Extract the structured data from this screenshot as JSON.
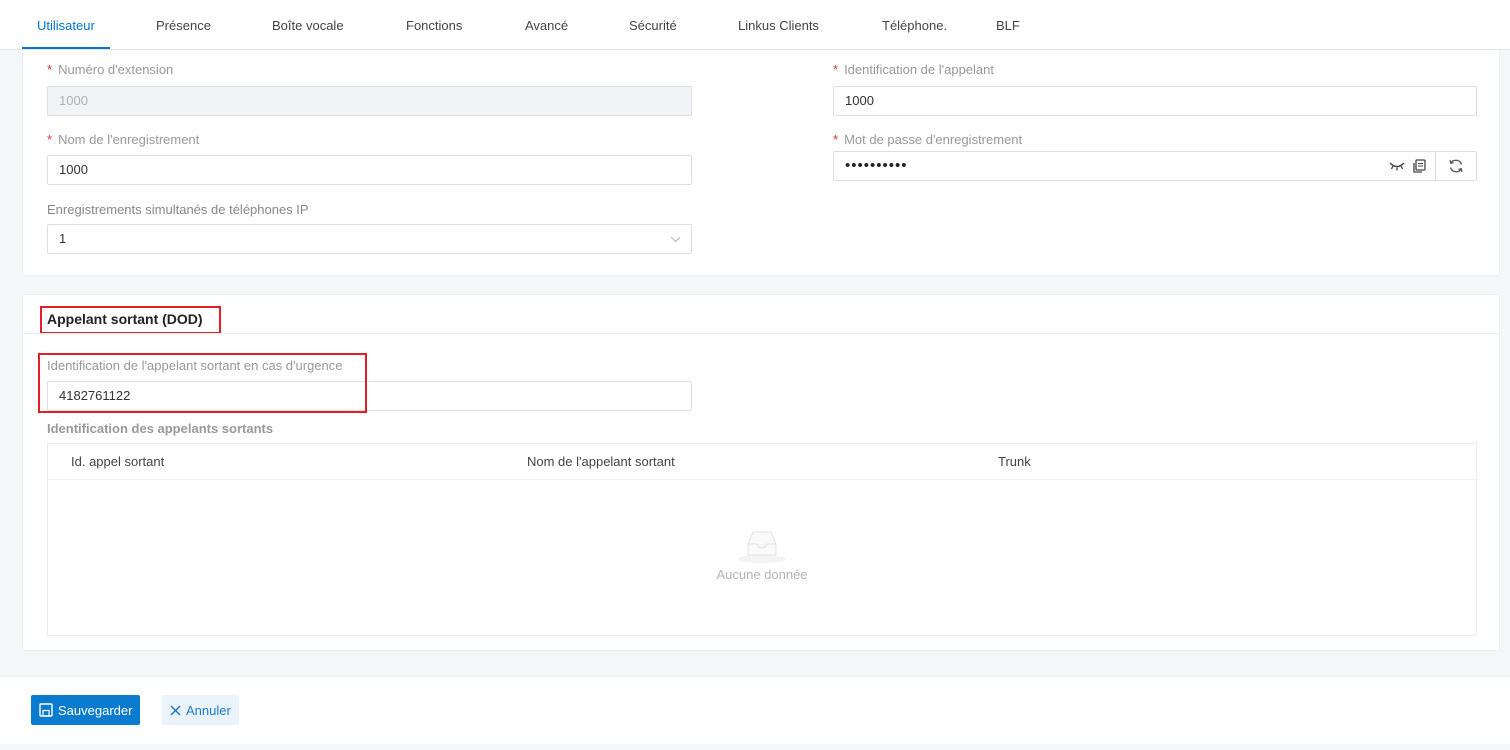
{
  "tabs": [
    {
      "label": "Utilisateur",
      "active": true
    },
    {
      "label": "Présence"
    },
    {
      "label": "Boîte vocale"
    },
    {
      "label": "Fonctions"
    },
    {
      "label": "Avancé"
    },
    {
      "label": "Sécurité"
    },
    {
      "label": "Linkus Clients"
    },
    {
      "label": "Téléphone."
    },
    {
      "label": "BLF"
    }
  ],
  "user": {
    "extension_label": "Numéro d'extension",
    "extension_value": "1000",
    "caller_id_label": "Identification de l'appelant",
    "caller_id_value": "1000",
    "reg_name_label": "Nom de l'enregistrement",
    "reg_name_value": "1000",
    "reg_password_label": "Mot de passe d'enregistrement",
    "reg_password_value": "••••••••••",
    "concurrent_label": "Enregistrements simultanés de téléphones IP",
    "concurrent_value": "1",
    "required_mark": "*"
  },
  "dod": {
    "title": "Appelant sortant (DOD)",
    "emergency_label": "Identification de l'appelant sortant en cas d'urgence",
    "emergency_value": "4182761122",
    "outbound_label": "Identification des appelants sortants",
    "table": {
      "columns": [
        "Id. appel sortant",
        "Nom de l'appelant sortant",
        "Trunk"
      ],
      "rows": [],
      "empty_text": "Aucune donnée"
    }
  },
  "footer": {
    "save_label": "Sauvegarder",
    "cancel_label": "Annuler"
  },
  "colors": {
    "accent": "#0076cc",
    "required": "#e0303a",
    "highlight_box": "#e01f26"
  },
  "icons": [
    "eye-closed-icon",
    "copy-icon",
    "refresh-icon",
    "chevron-down-icon",
    "empty-inbox-icon",
    "save-icon",
    "close-icon"
  ]
}
